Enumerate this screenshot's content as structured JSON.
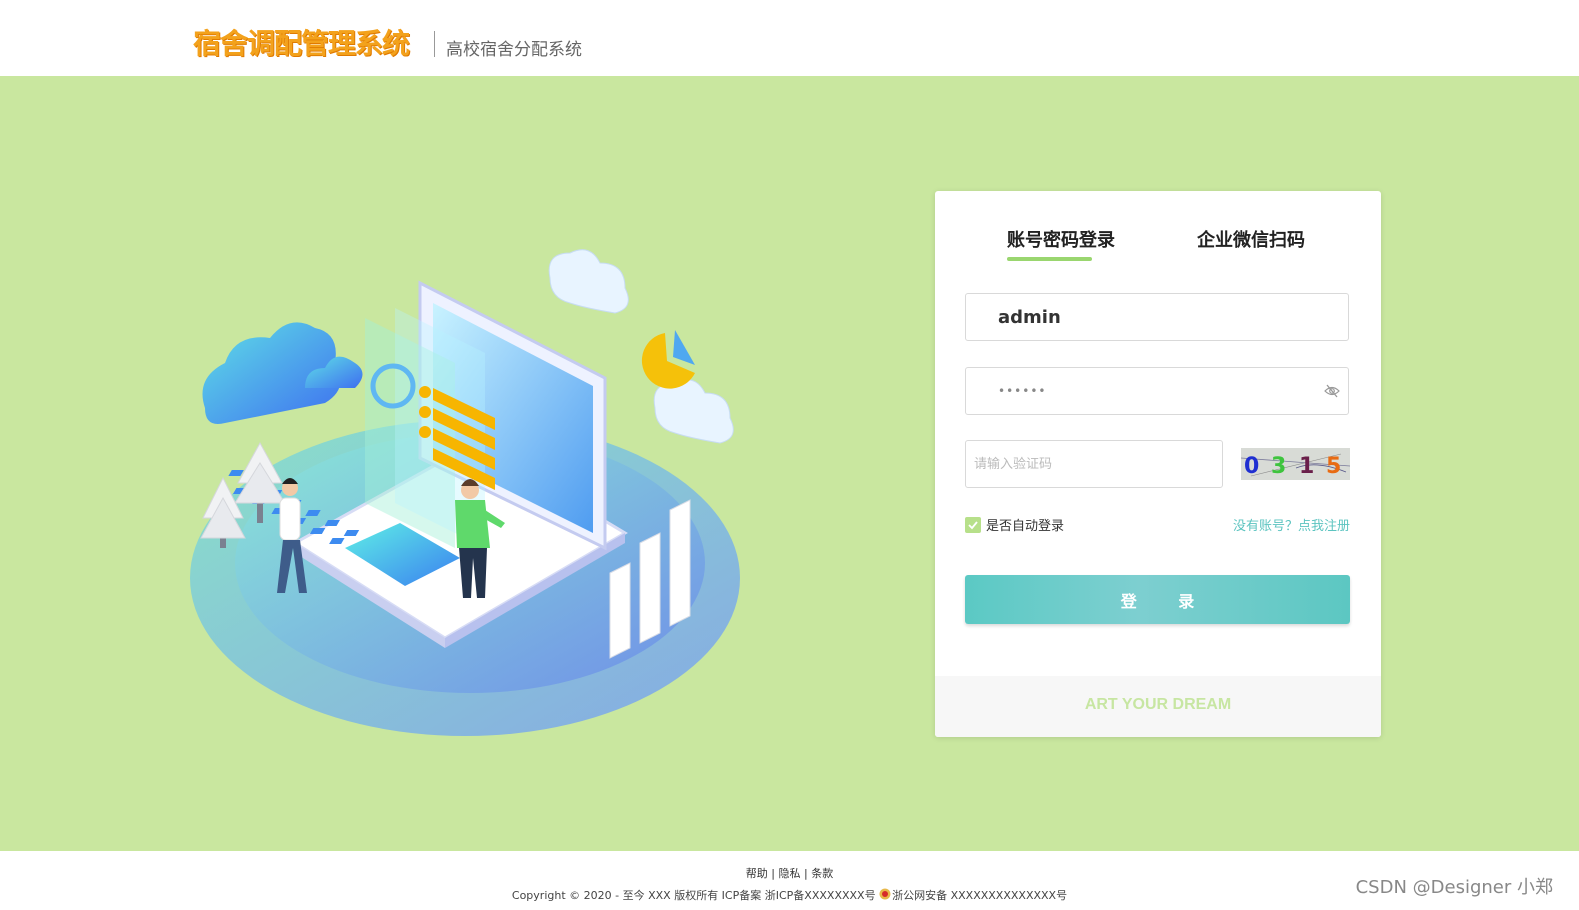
{
  "header": {
    "logo_title": "宿舍调配管理系统",
    "subtitle": "高校宿舍分配系统"
  },
  "login": {
    "tabs": [
      {
        "label": "账号密码登录",
        "active": true
      },
      {
        "label": "企业微信扫码",
        "active": false
      }
    ],
    "username_value": "admin",
    "password_value": "••••••",
    "captcha_placeholder": "请输入验证码",
    "captcha_code": "0315",
    "remember_label": "是否自动登录",
    "remember_checked": true,
    "register_link": "没有账号？点我注册",
    "login_button": "登 录",
    "slogan": "ART YOUR DREAM"
  },
  "footer": {
    "links": [
      "帮助",
      "隐私",
      "条款"
    ],
    "copyright": "Copyright © 2020 - 至今 XXX 版权所有 ICP备案 浙ICP备XXXXXXXX号",
    "police": "浙公网安备 XXXXXXXXXXXXXX号"
  },
  "watermark": "CSDN @Designer 小郑",
  "colors": {
    "background": "#c9e79f",
    "accent_teal": "#5bc9c4",
    "logo_orange": "#f3a21c",
    "tab_underline": "#9ad66f"
  },
  "icons": [
    "eye-slash-icon",
    "checkbox-check-icon",
    "police-badge-icon"
  ]
}
